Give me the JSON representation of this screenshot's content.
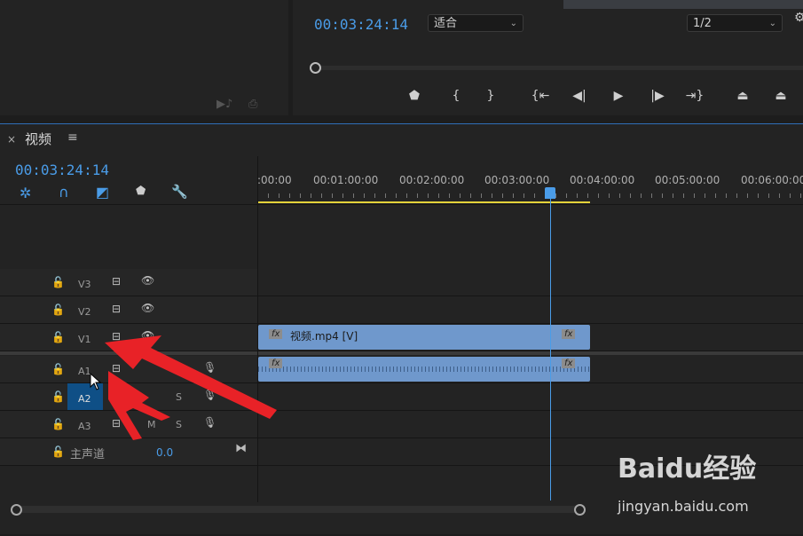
{
  "program": {
    "timecode": "00:03:24:14",
    "fit_value": "适合",
    "resolution_value": "1/2"
  },
  "timeline": {
    "tab_title": "视频",
    "timecode": "00:03:24:14",
    "ruler_labels": [
      ":00:00",
      "00:01:00:00",
      "00:02:00:00",
      "00:03:00:00",
      "00:04:00:00",
      "00:05:00:00",
      "00:06:00:00"
    ],
    "video_tracks": [
      {
        "label": "V3"
      },
      {
        "label": "V2"
      },
      {
        "label": "V1"
      }
    ],
    "audio_tracks": [
      {
        "label": "A1",
        "solo": "S"
      },
      {
        "label": "A2",
        "solo": "S"
      },
      {
        "label": "A3",
        "mute": "M",
        "solo": "S"
      }
    ],
    "master": {
      "label": "主声道",
      "value": "0.0"
    },
    "video_clip": {
      "name": "视频.mp4 [V]",
      "fx": "fx"
    },
    "audio_clip": {
      "fx": "fx"
    }
  },
  "watermark": {
    "brand": "Baidu经验",
    "url": "jingyan.baidu.com"
  },
  "colors": {
    "accent": "#4a9ce8",
    "clip": "#6f98cc",
    "arrow": "#e82227",
    "panel": "#232323"
  }
}
